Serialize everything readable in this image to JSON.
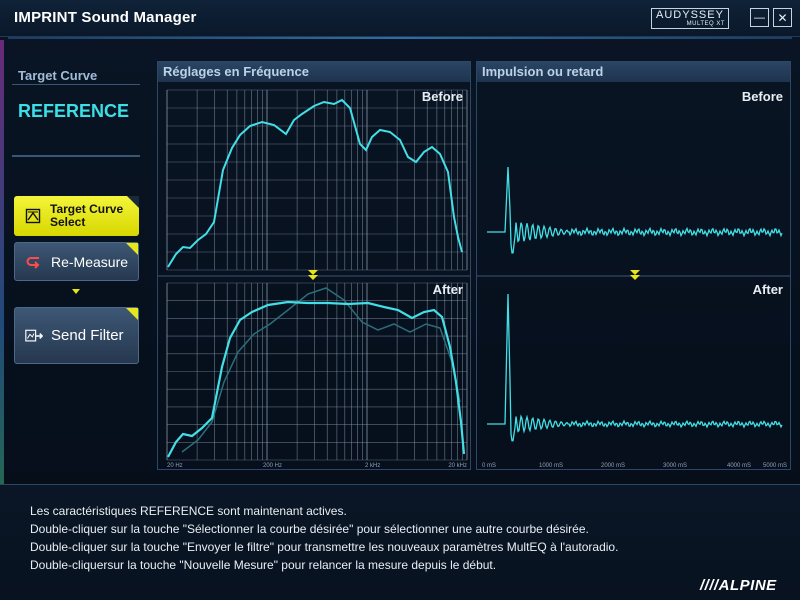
{
  "window": {
    "title": "IMPRINT Sound Manager",
    "logo_main": "AUDYSSEY",
    "logo_sub": "MULTEQ XT",
    "minimize_glyph": "—",
    "close_glyph": "✕"
  },
  "left": {
    "label": "Target Curve",
    "curve_name": "REFERENCE",
    "buttons": {
      "target_line1": "Target Curve",
      "target_line2": "Select",
      "remeasure": "Re-Measure",
      "send": "Send Filter"
    }
  },
  "freq": {
    "title": "Réglages en Fréquence",
    "before": "Before",
    "after": "After",
    "ticks": [
      "20 Hz",
      "200 Hz",
      "2 kHz",
      "20 kHz"
    ]
  },
  "impulse": {
    "title": "Impulsion ou retard",
    "before": "Before",
    "after": "After",
    "ticks": [
      "0 mS",
      "1000 mS",
      "2000 mS",
      "3000 mS",
      "4000 mS",
      "5000 mS"
    ]
  },
  "messages": [
    "Les caractéristiques REFERENCE sont maintenant actives.",
    "Double-cliquer sur la touche \"Sélectionner la courbe désirée\" pour sélectionner une autre courbe désirée.",
    "Double-cliquer sur la touche \"Envoyer le filtre\" pour transmettre les nouveaux paramètres MultEQ à l'autoradio.",
    "Double-cliquersur la touche \"Nouvelle Mesure\" pour relancer la mesure depuis le début."
  ],
  "brand": "////ALPINE",
  "colors": {
    "curve": "#43dfe6",
    "accent": "#e7e61a",
    "grid": "#8c9fb3"
  }
}
